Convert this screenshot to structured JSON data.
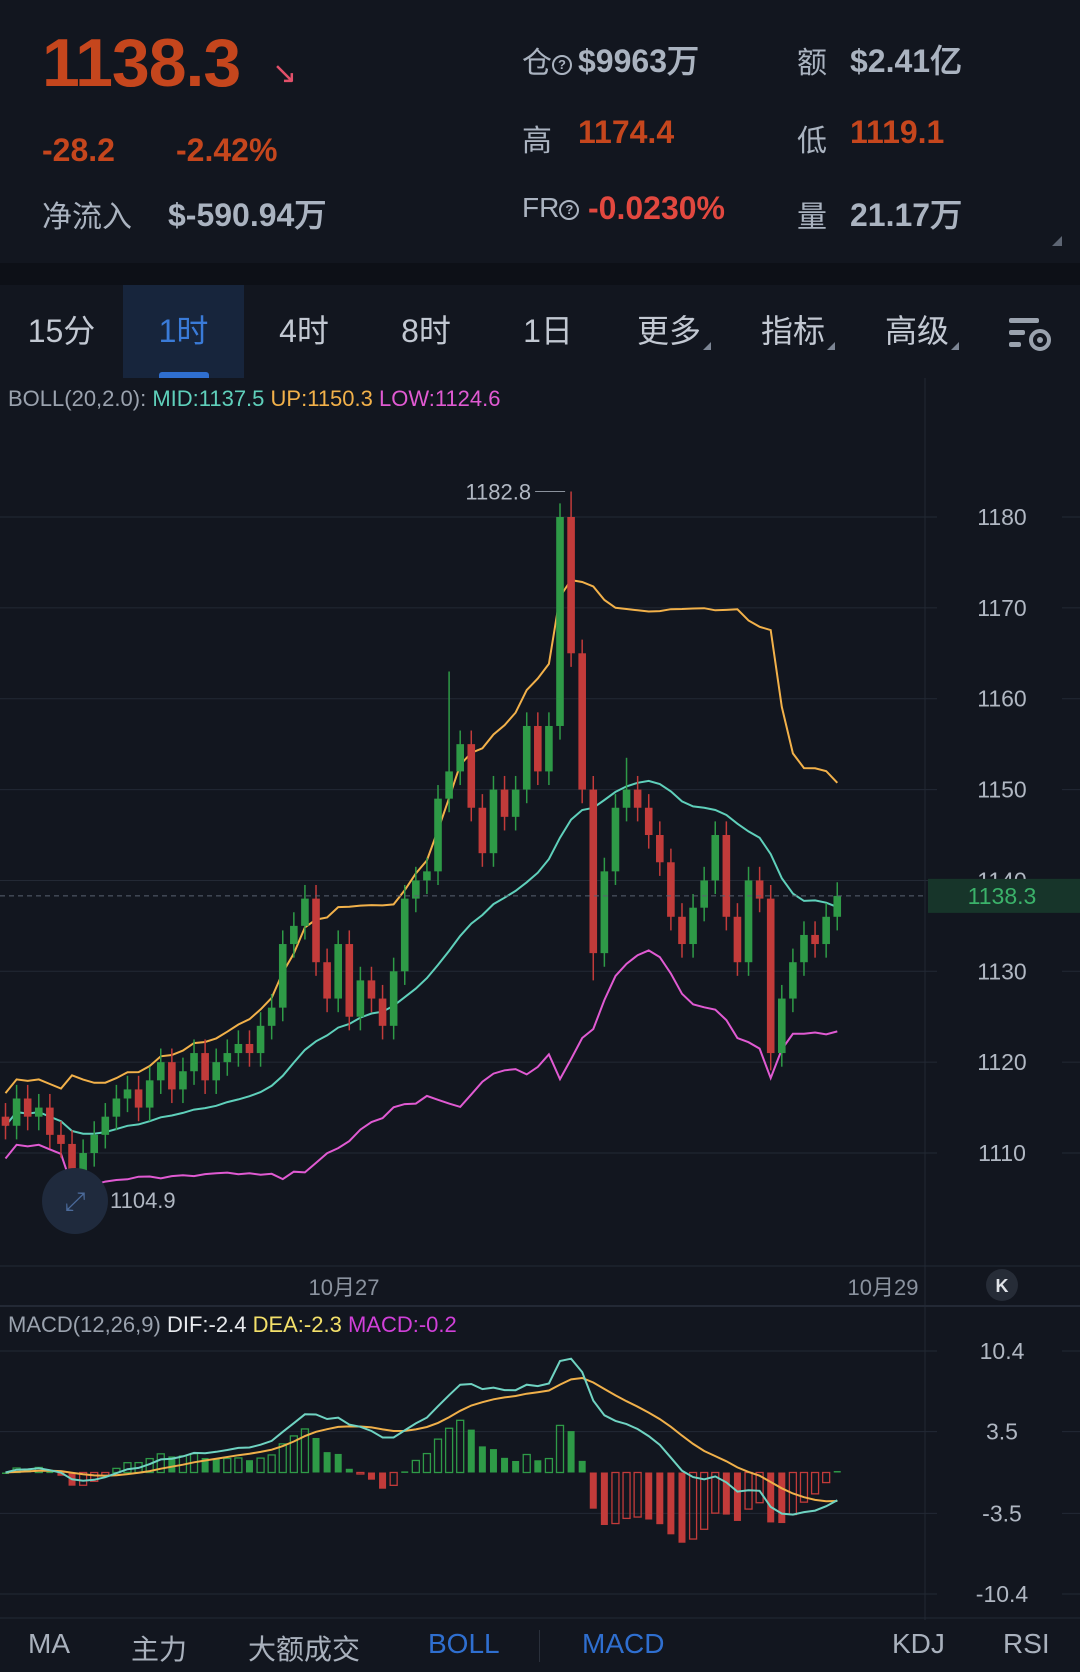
{
  "header": {
    "last_price": "1138.3",
    "direction_icon": "arrow-down-right",
    "change": "-28.2",
    "change_pct": "-2.42%",
    "net_inflow_label": "净流入",
    "net_inflow": "$-590.94万",
    "open_interest_label": "仓",
    "open_interest": "$9963万",
    "turnover_label": "额",
    "turnover": "$2.41亿",
    "high_label": "高",
    "high": "1174.4",
    "low_label": "低",
    "low": "1119.1",
    "funding_rate_label": "FR",
    "funding_rate": "-0.0230%",
    "volume_label": "量",
    "volume": "21.17万"
  },
  "tabs": [
    {
      "label": "15分"
    },
    {
      "label": "1时",
      "active": true
    },
    {
      "label": "4时"
    },
    {
      "label": "8时"
    },
    {
      "label": "1日"
    },
    {
      "label": "更多"
    },
    {
      "label": "指标"
    },
    {
      "label": "高级"
    }
  ],
  "boll_legend": {
    "name": "BOLL(20,2.0):",
    "mid": "MID:1137.5",
    "up": "UP:1150.3",
    "low": "LOW:1124.6"
  },
  "macd_legend": {
    "name": "MACD(12,26,9)",
    "dif": "DIF:-2.4",
    "dea": "DEA:-2.3",
    "macd": "MACD:-0.2"
  },
  "colors": {
    "up": "#2e9a47",
    "down": "#c23b3a",
    "mid": "#5fd0bb",
    "upper": "#f2b14a",
    "lower": "#e05ad2",
    "dif": "#6fd3c2",
    "dea": "#f0b04a",
    "accent": "#2f6fd0"
  },
  "chart_data": {
    "type": "candlestick",
    "interval": "1时",
    "price_axis": {
      "ticks": [
        "1180",
        "1170",
        "1160",
        "1150",
        "1140",
        "1130",
        "1120",
        "1110"
      ],
      "range": [
        1100,
        1185
      ]
    },
    "current_price_label": "1138.3",
    "max_label": "1182.8",
    "min_label": "1104.9",
    "date_labels": [
      "10月27",
      "10月29"
    ],
    "closes": [
      1113,
      1116,
      1114,
      1115,
      1112,
      1111,
      1106,
      1110,
      1112,
      1114,
      1116,
      1117,
      1115,
      1118,
      1120,
      1117,
      1119,
      1121,
      1118,
      1120,
      1121,
      1122,
      1121,
      1124,
      1126,
      1133,
      1135,
      1138,
      1131,
      1127,
      1133,
      1125,
      1129,
      1127,
      1124,
      1130,
      1138,
      1140,
      1141,
      1149,
      1152,
      1155,
      1148,
      1143,
      1150,
      1147,
      1150,
      1157,
      1152,
      1157,
      1180,
      1165,
      1150,
      1132,
      1141,
      1148,
      1150,
      1148,
      1145,
      1142,
      1136,
      1133,
      1137,
      1140,
      1145,
      1136,
      1131,
      1140,
      1138,
      1121,
      1127,
      1131,
      1134,
      1133,
      1136,
      1138.3
    ],
    "high_overrides": {
      "51": 1182.8,
      "40": 1163,
      "56": 1153.5
    },
    "low_overrides": {
      "6": 1104.9,
      "53": 1129,
      "69": 1119.1
    },
    "macd_axis": {
      "ticks": [
        "10.4",
        "3.5",
        "-3.5",
        "-10.4"
      ]
    }
  },
  "bottom_tabs": [
    {
      "label": "MA"
    },
    {
      "label": "主力"
    },
    {
      "label": "大额成交"
    },
    {
      "label": "BOLL",
      "active": true
    },
    {
      "label": "MACD",
      "active": true
    },
    {
      "label": "KDJ"
    },
    {
      "label": "RSI"
    }
  ]
}
